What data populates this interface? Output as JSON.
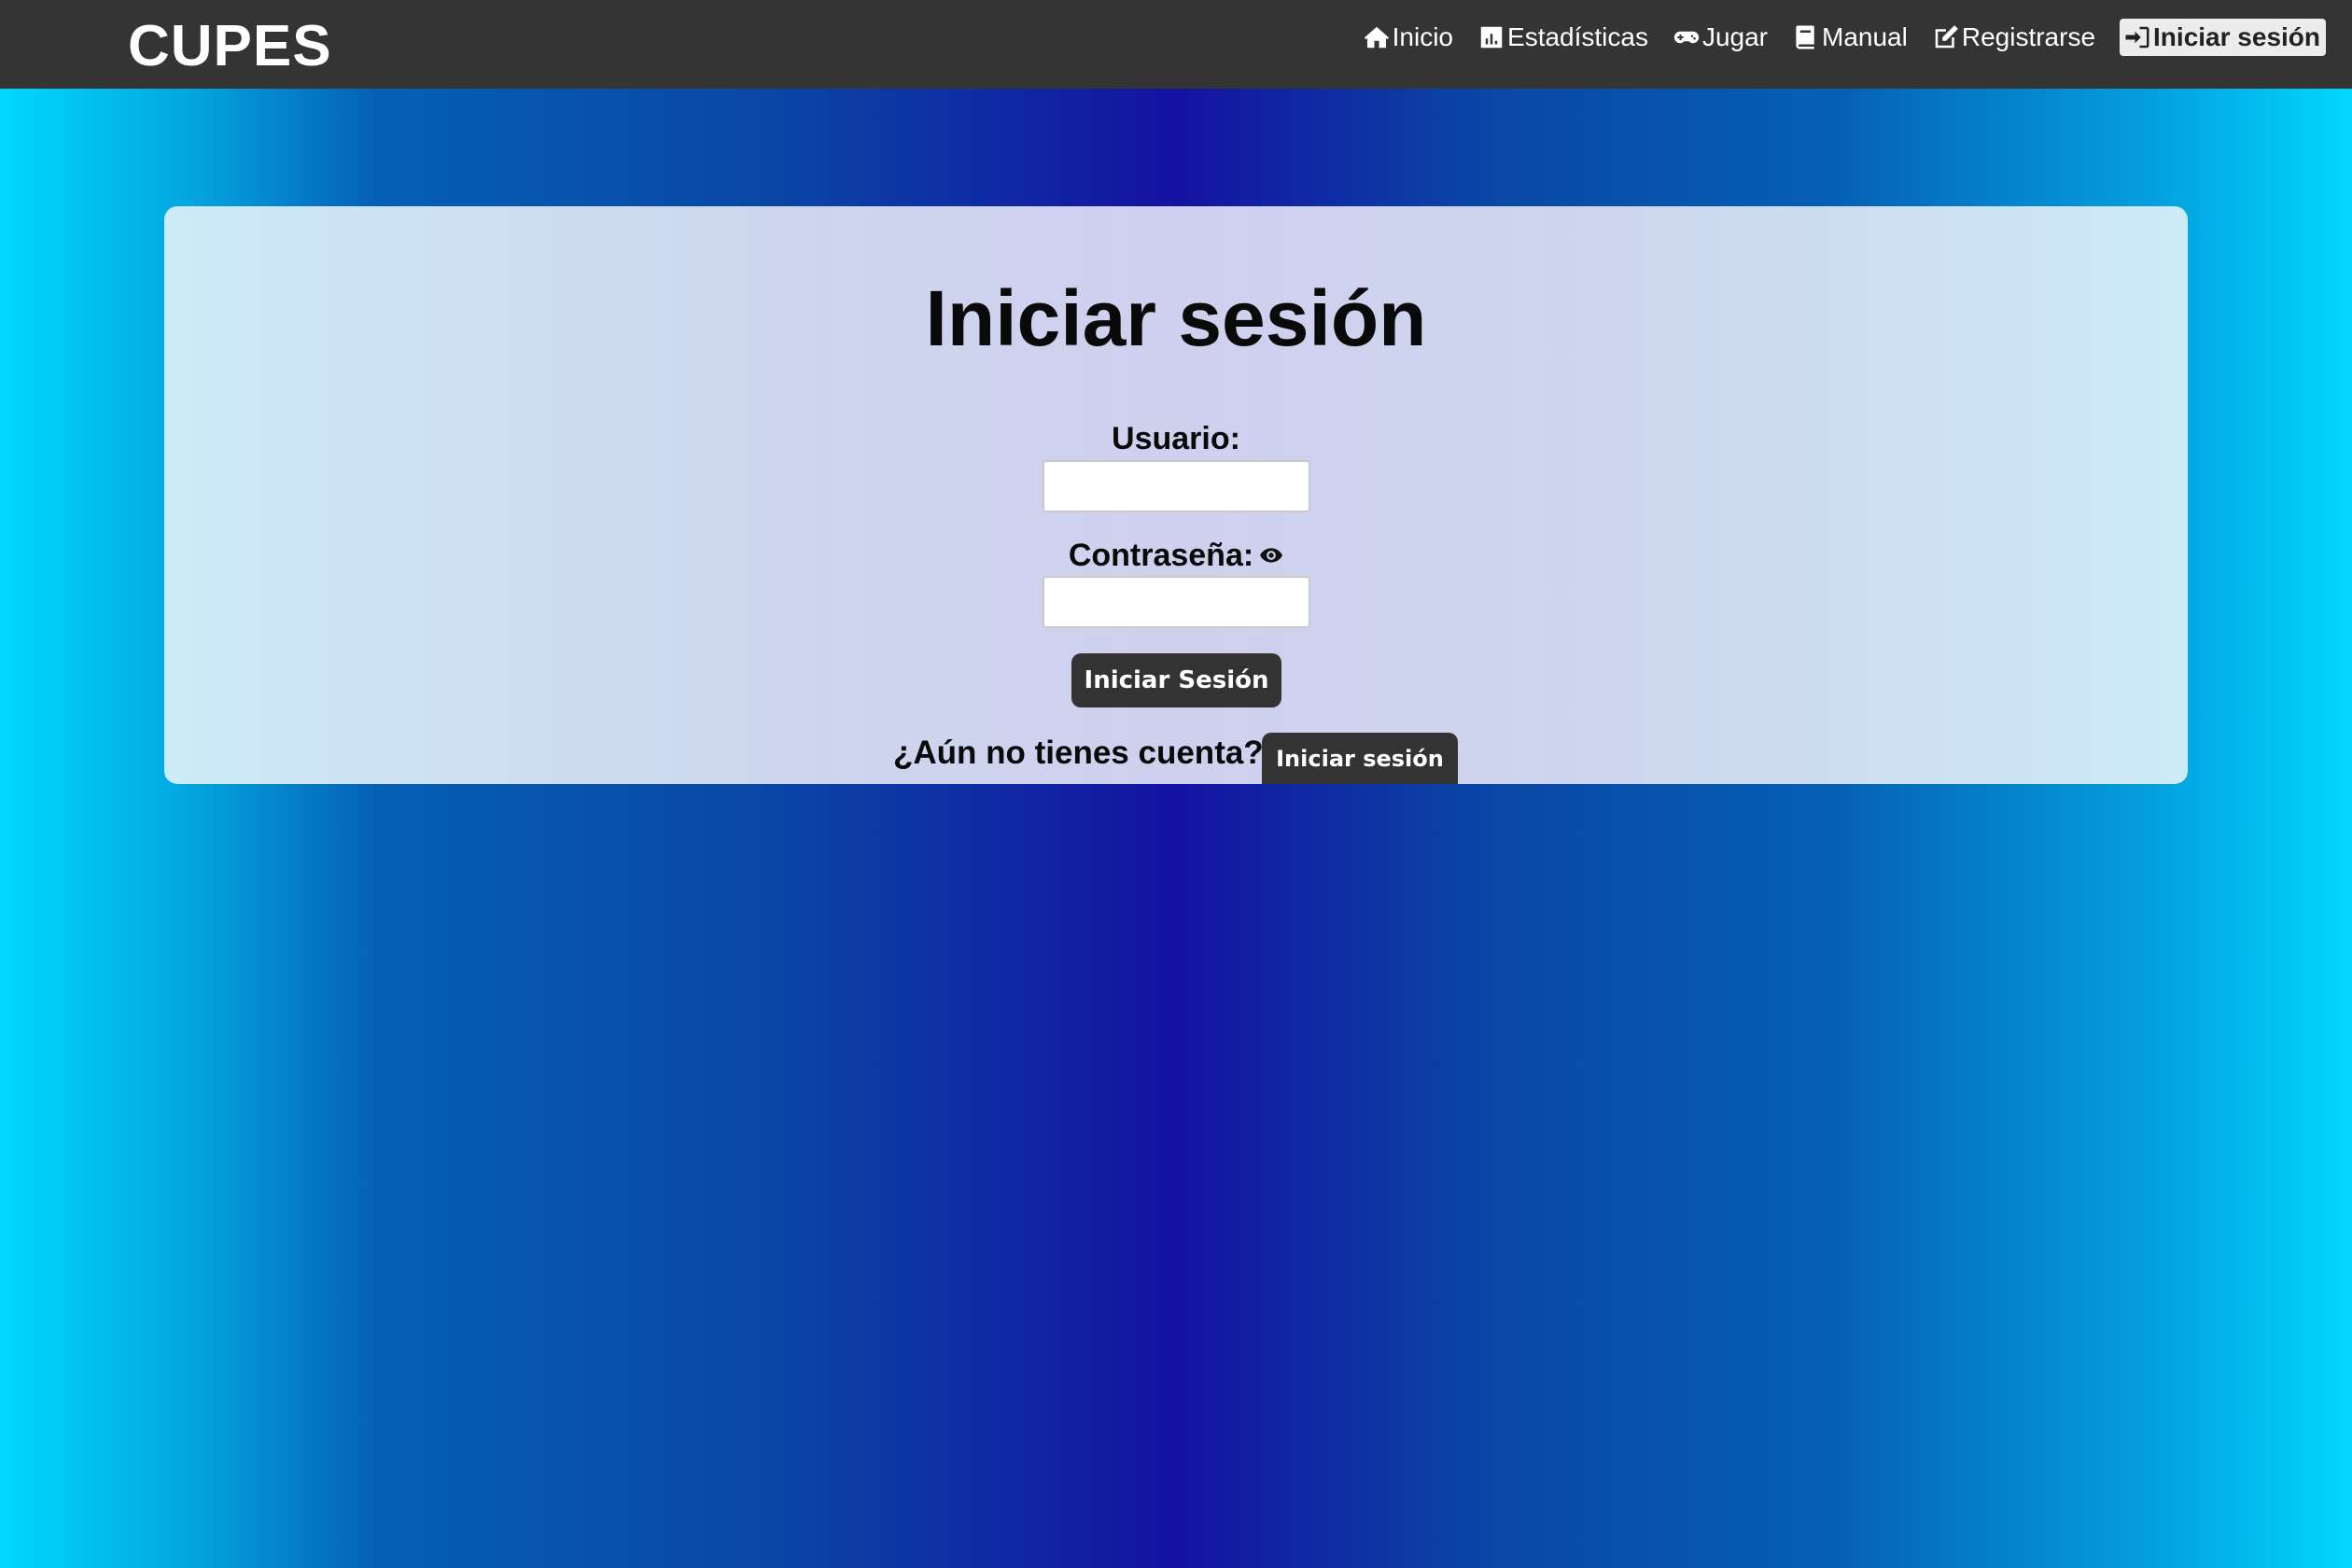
{
  "navbar": {
    "brand": "CUPES",
    "items": [
      {
        "label": "Inicio",
        "icon": "home-icon"
      },
      {
        "label": "Estadísticas",
        "icon": "chart-icon"
      },
      {
        "label": "Jugar",
        "icon": "gamepad-icon"
      },
      {
        "label": "Manual",
        "icon": "book-icon"
      },
      {
        "label": "Registrarse",
        "icon": "edit-icon"
      },
      {
        "label": "Iniciar sesión",
        "icon": "sign-in-icon",
        "active": true
      }
    ]
  },
  "login": {
    "title": "Iniciar sesión",
    "username_label": "Usuario:",
    "username_value": "",
    "password_label": "Contraseña:",
    "password_value": "",
    "password_toggle_icon": "eye-icon",
    "submit_label": "Iniciar Sesión",
    "signup_prompt": "¿Aún no tienes cuenta?",
    "signup_button": "Iniciar sesión"
  },
  "colors": {
    "navbar_bg": "#343434",
    "button_bg": "#333333",
    "gradient_edge": "#00d8ff",
    "gradient_center": "#1412a2"
  }
}
